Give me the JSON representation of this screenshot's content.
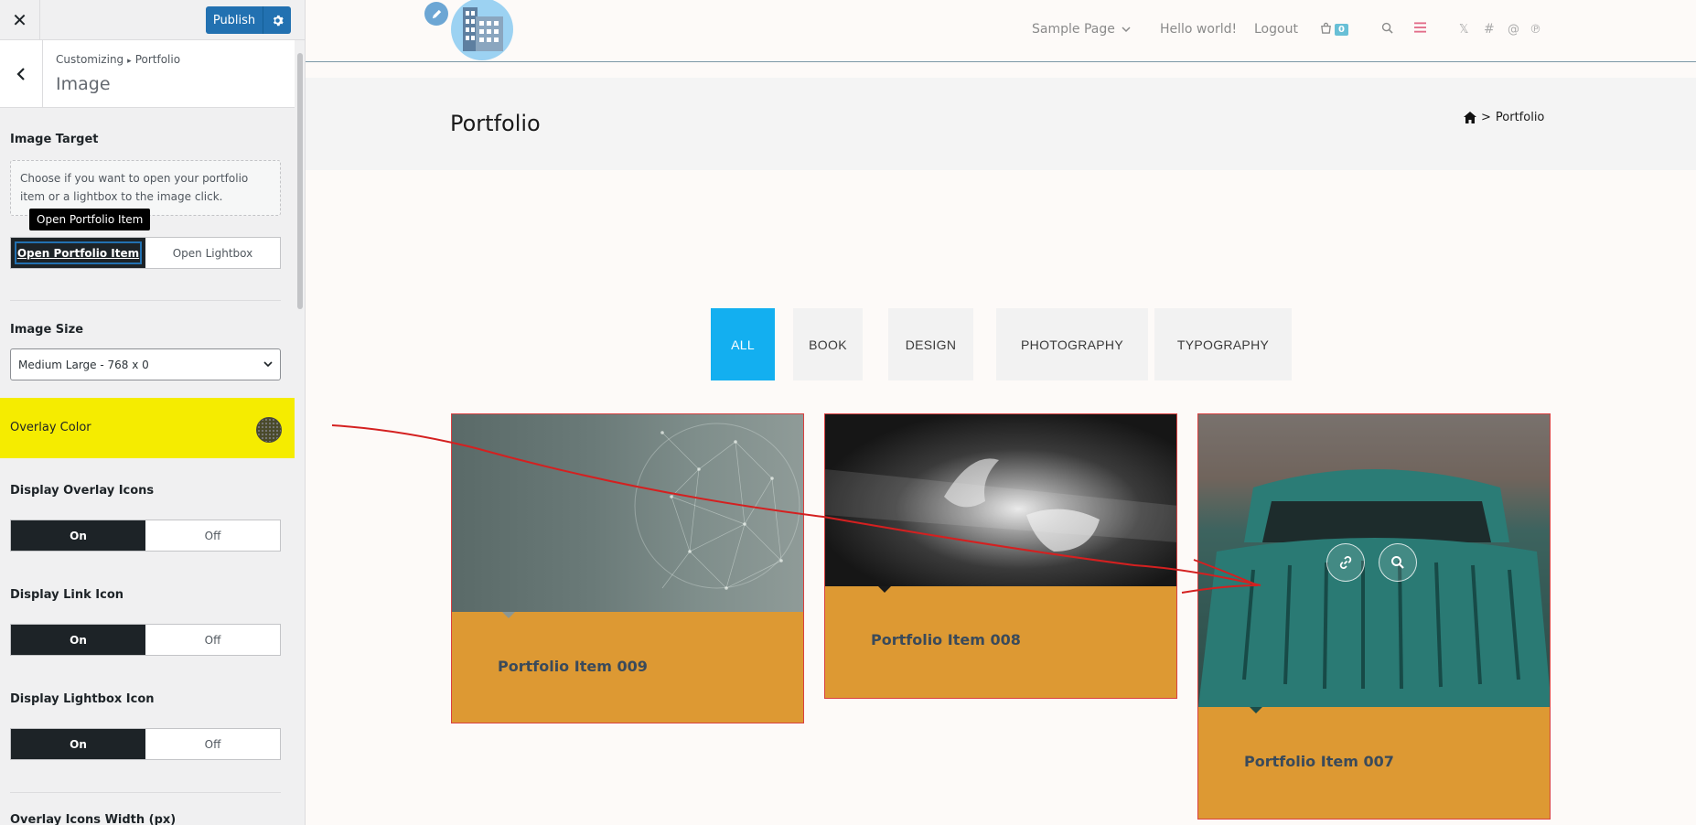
{
  "customizer": {
    "close_icon": "close-icon",
    "publish_label": "Publish",
    "breadcrumb_root": "Customizing",
    "breadcrumb_section": "Portfolio",
    "section_title": "Image",
    "image_target": {
      "label": "Image Target",
      "description": "Choose if you want to open your portfolio item or a lightbox to the image click.",
      "tooltip": "Open Portfolio Item",
      "options": [
        "Open Portfolio Item",
        "Open Lightbox"
      ],
      "selected": "Open Portfolio Item"
    },
    "image_size": {
      "label": "Image Size",
      "value": "Medium Large - 768 x 0"
    },
    "overlay_color": {
      "label": "Overlay Color",
      "highlight": "#f5ec00"
    },
    "display_overlay_icons": {
      "label": "Display Overlay Icons",
      "on": "On",
      "off": "Off",
      "selected": "On"
    },
    "display_link_icon": {
      "label": "Display Link Icon",
      "on": "On",
      "off": "Off",
      "selected": "On"
    },
    "display_lightbox_icon": {
      "label": "Display Lightbox Icon",
      "on": "On",
      "off": "Off",
      "selected": "On"
    },
    "overlay_icons_width_label": "Overlay Icons Width (px)"
  },
  "site": {
    "nav": {
      "sample_page": "Sample Page",
      "hello_world": "Hello world!",
      "logout": "Logout",
      "cart_count": "0"
    },
    "page_title": "Portfolio",
    "breadcrumb_current": "Portfolio",
    "filters": [
      "ALL",
      "BOOK",
      "DESIGN",
      "PHOTOGRAPHY",
      "TYPOGRAPHY"
    ],
    "active_filter": "ALL",
    "accent_color": "#13aff0",
    "card_color": "#dd9933",
    "items": [
      {
        "title": "Portfolio Item 009"
      },
      {
        "title": "Portfolio Item 008"
      },
      {
        "title": "Portfolio Item 007"
      }
    ]
  }
}
